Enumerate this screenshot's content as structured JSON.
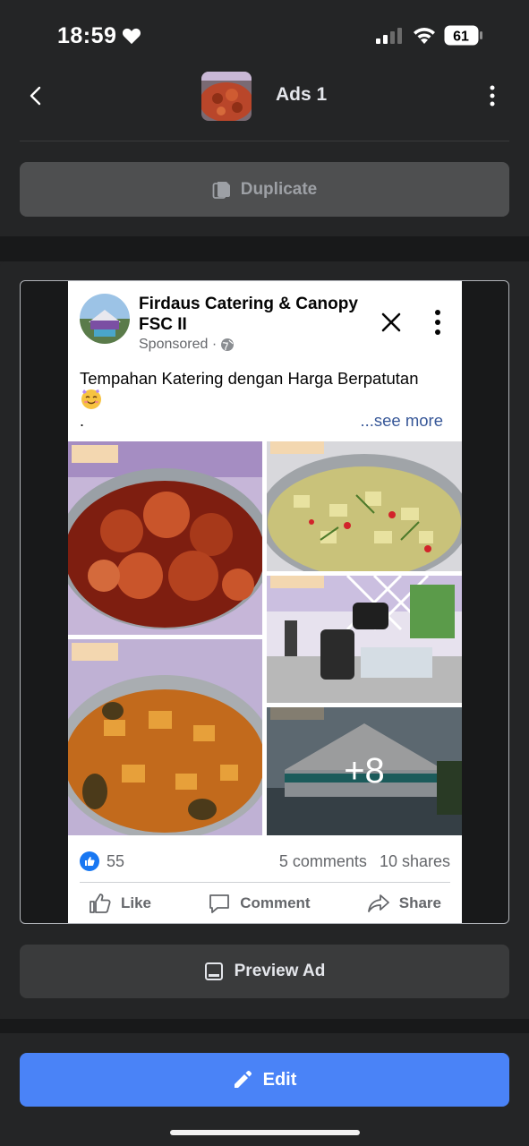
{
  "status_bar": {
    "time": "18:59",
    "battery": "61"
  },
  "header": {
    "title": "Ads 1"
  },
  "duplicate_button": {
    "label": "Duplicate"
  },
  "post": {
    "page_name": "Firdaus Catering & Canopy FSC II",
    "sponsored": "Sponsored ·",
    "text": "Tempahan Katering dengan Harga Berpatutan",
    "dot": ".",
    "see_more": "...see more",
    "more_photos": "+8",
    "like_count": "55",
    "comments": "5 comments",
    "shares": "10 shares",
    "actions": {
      "like": "Like",
      "comment": "Comment",
      "share": "Share"
    },
    "photos": [
      "chicken-curry",
      "mango-salad",
      "buffet-table",
      "vegetable-curry",
      "canopy-tent"
    ]
  },
  "preview_button": {
    "label": "Preview Ad"
  },
  "edit_button": {
    "label": "Edit"
  },
  "colors": {
    "accent": "#4a83f7",
    "fb_blue": "#1877f2",
    "link": "#385898",
    "background": "#242526"
  }
}
